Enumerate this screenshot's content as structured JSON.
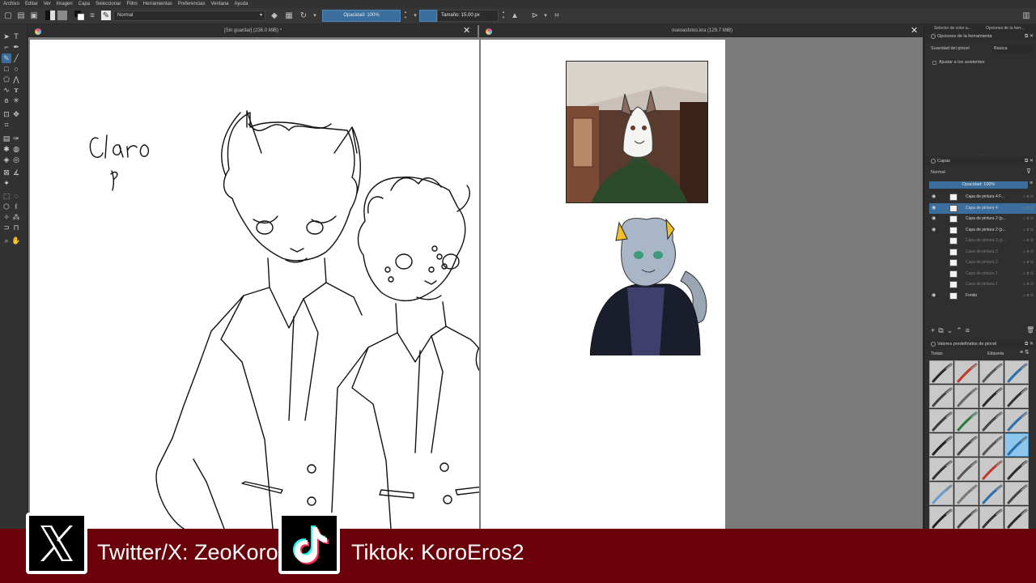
{
  "menubar": {
    "items": [
      "Archivo",
      "Editar",
      "Ver",
      "Imagen",
      "Capa",
      "Seleccionar",
      "Filtro",
      "Herramientas",
      "Preferencias",
      "Ventana",
      "Ayuda"
    ]
  },
  "toolbar": {
    "blend_mode": "Normal",
    "opacity_label": "Opacidad: 100%",
    "size_label": "Tamaño: 15.00 px"
  },
  "documents": {
    "tab1_title": "[Sin guardar]  (236.0 MiB) *",
    "tab2_title": "nuevasfotos.kra (129.7 MiB)"
  },
  "canvas": {
    "handwriting": "Claro"
  },
  "right_dock": {
    "top_tabs": [
      "Selector de color a...",
      "Opciones de la herr..."
    ],
    "tool_options_title": "Opciones de la herramienta",
    "smoothing_label": "Suavidad del pincel",
    "smoothing_value": "Básica",
    "assistants_label": "Ajustar a los asistentes",
    "layers_title": "Capas",
    "layers_blend": "Normal",
    "layers_opacity": "Opacidad: 100%",
    "layers": [
      {
        "name": "Capa de pintura 4 F...",
        "visible": true,
        "selected": false,
        "dim": false
      },
      {
        "name": "Capa de pintura 4",
        "visible": true,
        "selected": true,
        "dim": false
      },
      {
        "name": "Capa de pintura 2 (p...",
        "visible": true,
        "selected": false,
        "dim": false
      },
      {
        "name": "Capa de pintura 2 (p...",
        "visible": true,
        "selected": false,
        "dim": false
      },
      {
        "name": "Capa de pintura 3 (p...",
        "visible": false,
        "selected": false,
        "dim": true
      },
      {
        "name": "Capa de pintura 3",
        "visible": false,
        "selected": false,
        "dim": true
      },
      {
        "name": "Capa de pintura 2",
        "visible": false,
        "selected": false,
        "dim": true
      },
      {
        "name": "Capa de pintura 1",
        "visible": false,
        "selected": false,
        "dim": true
      },
      {
        "name": "Capa de pintura 1",
        "visible": false,
        "selected": false,
        "dim": true
      },
      {
        "name": "Fondo",
        "visible": true,
        "selected": false,
        "dim": false
      }
    ],
    "brush_presets_title": "Valores predefinidos de pincel",
    "brush_filter": "Todas",
    "brush_tag": "Etiqueta"
  },
  "banner": {
    "twitter_label": "Twitter/X: ZeoKoro",
    "tiktok_label": "Tiktok: KoroEros2"
  },
  "colors": {
    "banner_bg": "#6a0009",
    "accent": "#3b6e9c",
    "canvas": "#ffffff"
  }
}
